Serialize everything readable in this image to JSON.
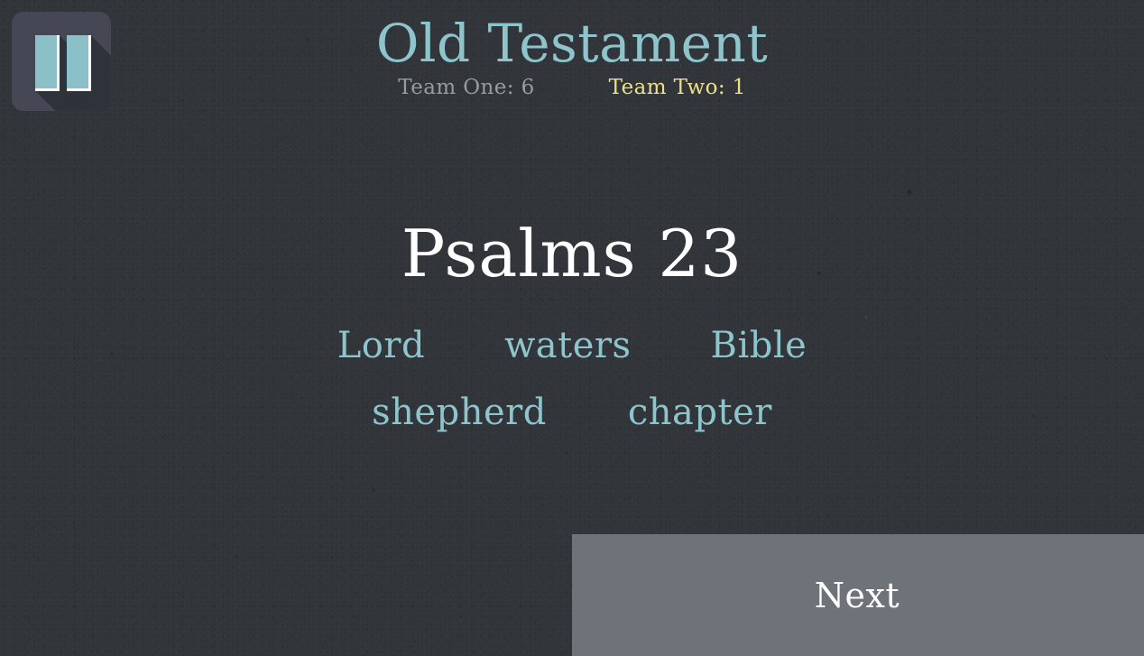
{
  "background_color": "#32363b",
  "header": {
    "title": "Old Testament",
    "title_color": "#8ec4cc",
    "teams": [
      {
        "label": "Team One: 6",
        "name": "Team One",
        "score": 6,
        "color": "#9a9b9d"
      },
      {
        "label": "Team Two: 1",
        "name": "Team Two",
        "score": 1,
        "color": "#ece08a"
      }
    ]
  },
  "pause_button": {
    "icon": "pause-icon",
    "bar_color": "#8bc0c9",
    "panel_color": "#454854",
    "shadow_color": "#2e323b"
  },
  "card": {
    "target_word": "Psalms 23",
    "target_word_color": "#ffffff",
    "taboo_color": "#8ec4cc",
    "taboo_words_row_one": [
      "Lord",
      "waters",
      "Bible"
    ],
    "taboo_words_row_two": [
      "shepherd",
      "chapter"
    ]
  },
  "next_button": {
    "label": "Next",
    "background_color": "#6e737a",
    "text_color": "#ffffff"
  }
}
